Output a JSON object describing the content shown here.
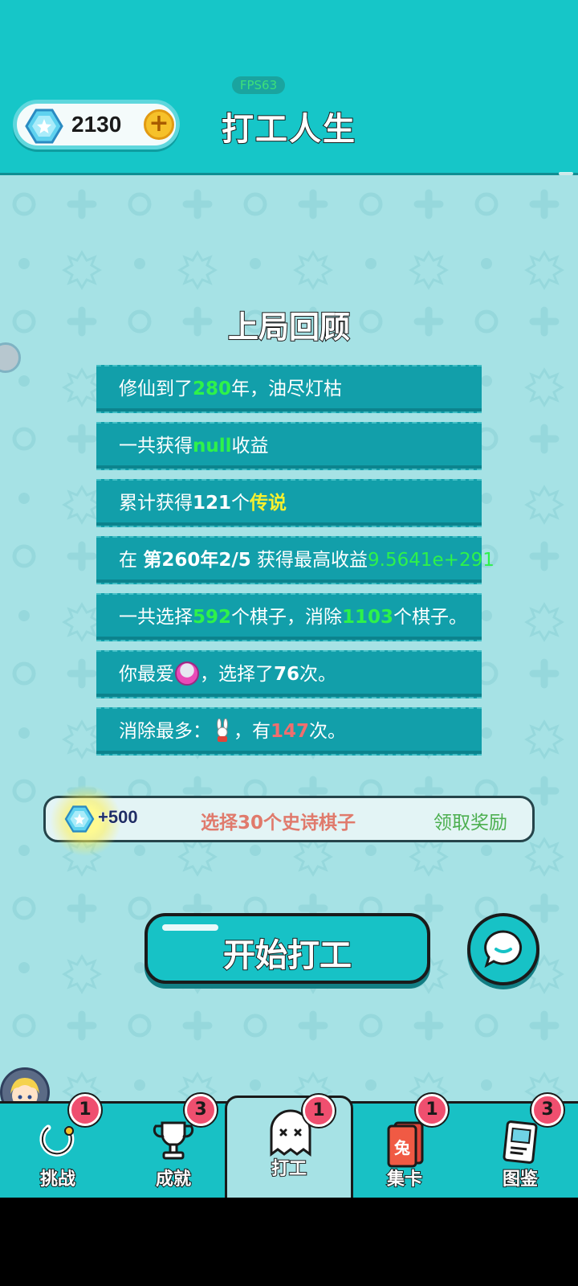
{
  "header": {
    "fps": "FPS63",
    "gem_count": "2130",
    "plus": "+",
    "title": "打工人生"
  },
  "review": {
    "title": "上局回顾",
    "row1": {
      "a": "修仙到了",
      "years": "280",
      "b": "年，油尽灯枯"
    },
    "row2": {
      "a": "一共获得",
      "value": "null",
      "b": "收益"
    },
    "row3": {
      "a": "累计获得",
      "count": "121",
      "b": "个",
      "rarity": "传说"
    },
    "row4": {
      "a": "在 ",
      "when": "第260年2/5",
      "b": " 获得最高收益",
      "value": "9.5641e+291"
    },
    "row5": {
      "a": "一共选择",
      "chosen": "592",
      "b": "个棋子，消除",
      "removed": "1103",
      "c": "个棋子。"
    },
    "row6": {
      "a": "你最爱",
      "b": "，选择了",
      "times": "76",
      "c": "次。"
    },
    "row7": {
      "a": "消除最多：",
      "b": "，有",
      "times": "147",
      "c": "次。"
    }
  },
  "task": {
    "reward": "+500",
    "description": "选择30个史诗棋子",
    "claim": "领取奖励"
  },
  "start_button": "开始打工",
  "nav": [
    {
      "label": "挑战",
      "badge": "1",
      "icon": "challenge-ring-icon"
    },
    {
      "label": "成就",
      "badge": "3",
      "icon": "trophy-icon"
    },
    {
      "label": "打工",
      "badge": "1",
      "icon": "ghost-icon"
    },
    {
      "label": "集卡",
      "badge": "1",
      "icon": "card-icon",
      "card_char": "兔"
    },
    {
      "label": "图鉴",
      "badge": "3",
      "icon": "handbook-icon"
    }
  ],
  "colors": {
    "header": "#16c6c8",
    "background": "#a6e2e5",
    "row": "#129faa",
    "highlight_green": "#2ef24a",
    "highlight_yellow": "#f7f02e",
    "highlight_red": "#f06e6e",
    "badge": "#ef4f6f"
  }
}
